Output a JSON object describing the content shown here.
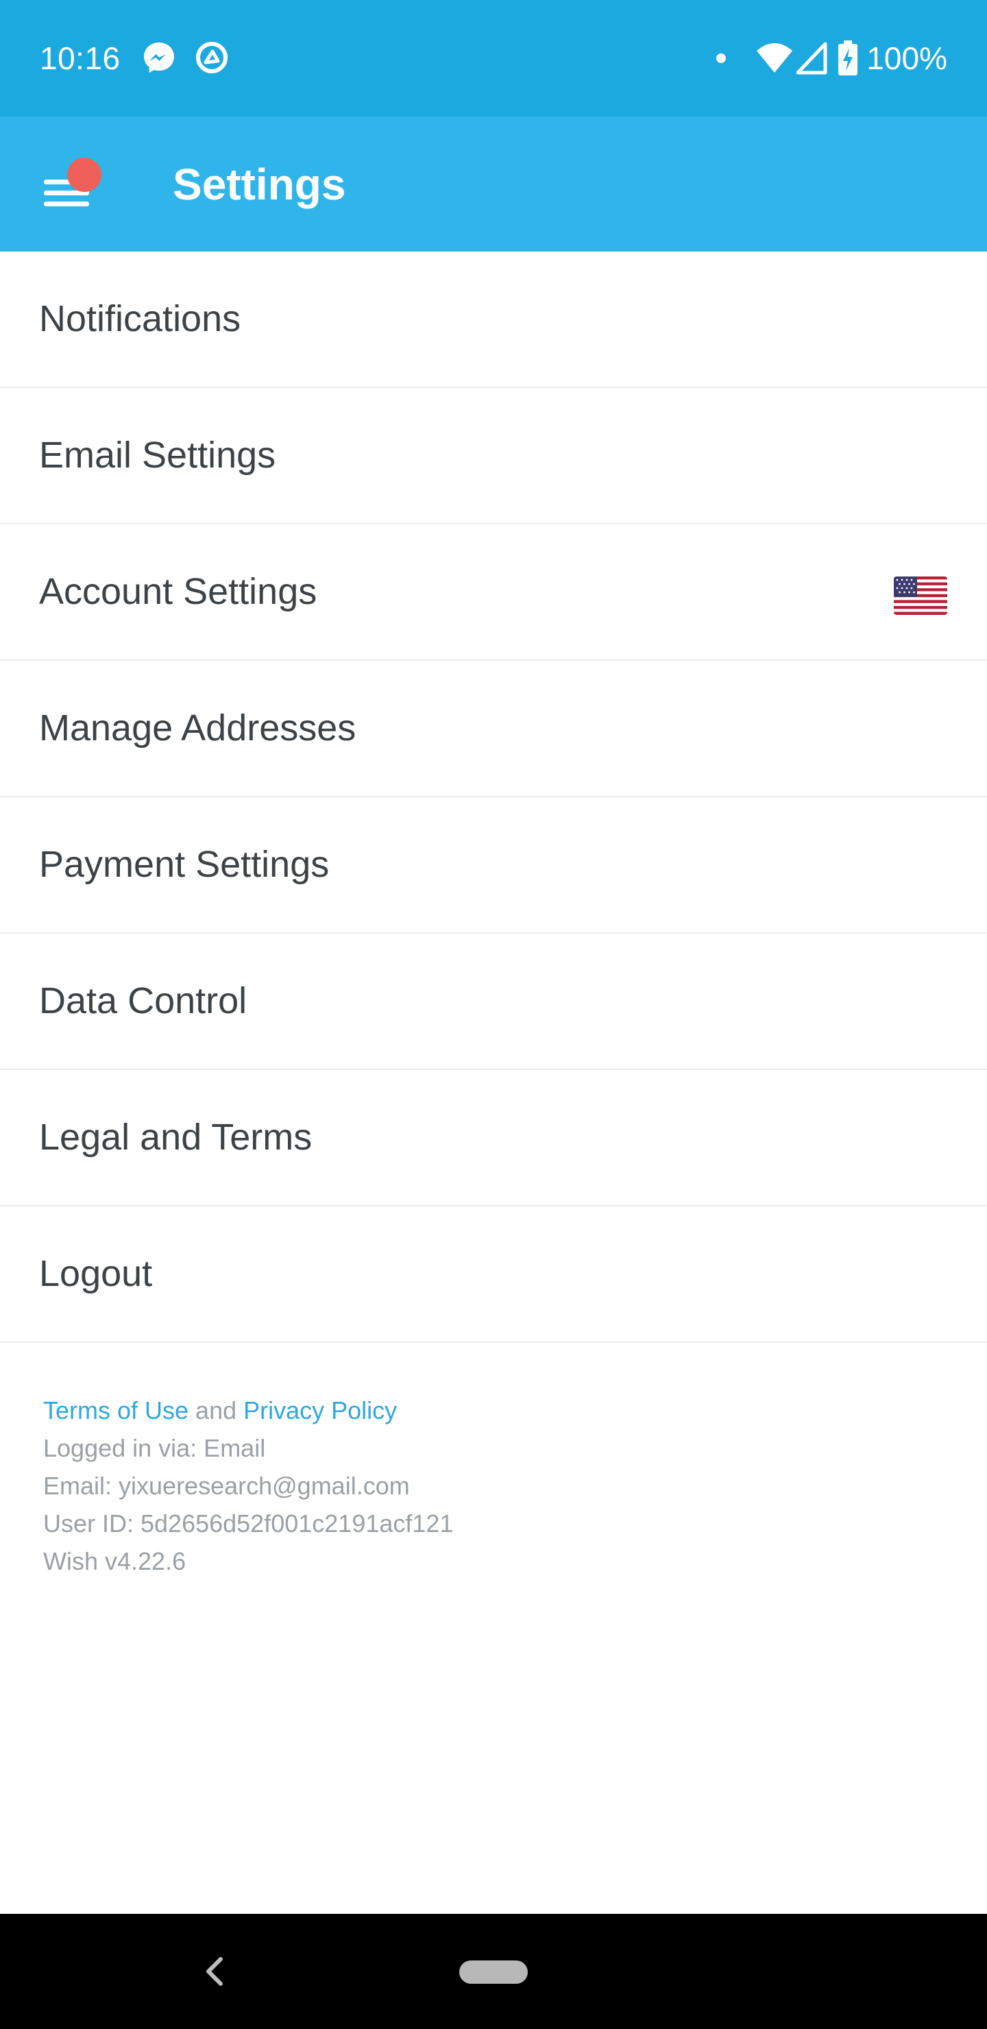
{
  "status_bar": {
    "time": "10:16",
    "battery_pct": "100%",
    "icons": [
      "messenger-icon",
      "app-notification-icon",
      "dot-icon",
      "wifi-icon",
      "cellular-signal-icon",
      "battery-charging-icon"
    ]
  },
  "app_bar": {
    "title": "Settings",
    "menu_icon": "hamburger-menu-icon",
    "badge_color": "#f0605a",
    "color": "#2fb5ea"
  },
  "settings": {
    "items": [
      {
        "label": "Notifications"
      },
      {
        "label": "Email Settings"
      },
      {
        "label": "Account Settings",
        "icon": "us-flag-icon"
      },
      {
        "label": "Manage Addresses"
      },
      {
        "label": "Payment Settings"
      },
      {
        "label": "Data Control"
      },
      {
        "label": "Legal and Terms"
      },
      {
        "label": "Logout"
      }
    ]
  },
  "footer": {
    "terms_link": "Terms of Use",
    "and_text": " and ",
    "privacy_link": "Privacy Policy",
    "logged_in": "Logged in via: Email",
    "email": "Email: yixueresearch@gmail.com",
    "user_id": "User ID: 5d2656d52f001c2191acf121",
    "version": "Wish v4.22.6",
    "link_color": "#2fa7e0"
  },
  "nav_bar": {
    "back_icon": "back-chevron-icon",
    "home_icon": "home-pill-icon"
  }
}
